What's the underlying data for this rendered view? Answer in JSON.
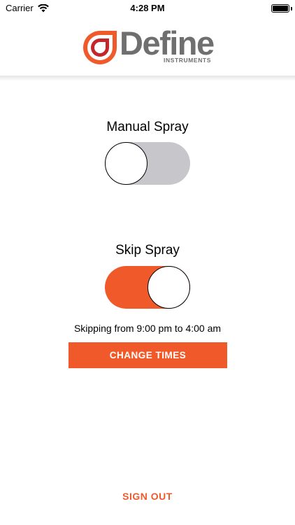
{
  "status_bar": {
    "carrier": "Carrier",
    "time": "4:28 PM",
    "icons": [
      "wifi-icon",
      "battery-icon"
    ]
  },
  "logo": {
    "name": "Define",
    "sub": "INSTRUMENTS",
    "colors": {
      "accent": "#f05a2a",
      "dark": "#c1272d",
      "text": "#6f6f6f"
    }
  },
  "manual_spray": {
    "label": "Manual Spray",
    "state": "off"
  },
  "skip_spray": {
    "label": "Skip Spray",
    "state": "on",
    "schedule_text": "Skipping from 9:00 pm to 4:00 am"
  },
  "change_times_button": "CHANGE TIMES",
  "sign_out": "SIGN OUT",
  "colors": {
    "accent": "#f05a2a",
    "toggle_off": "#c6c6cb"
  }
}
